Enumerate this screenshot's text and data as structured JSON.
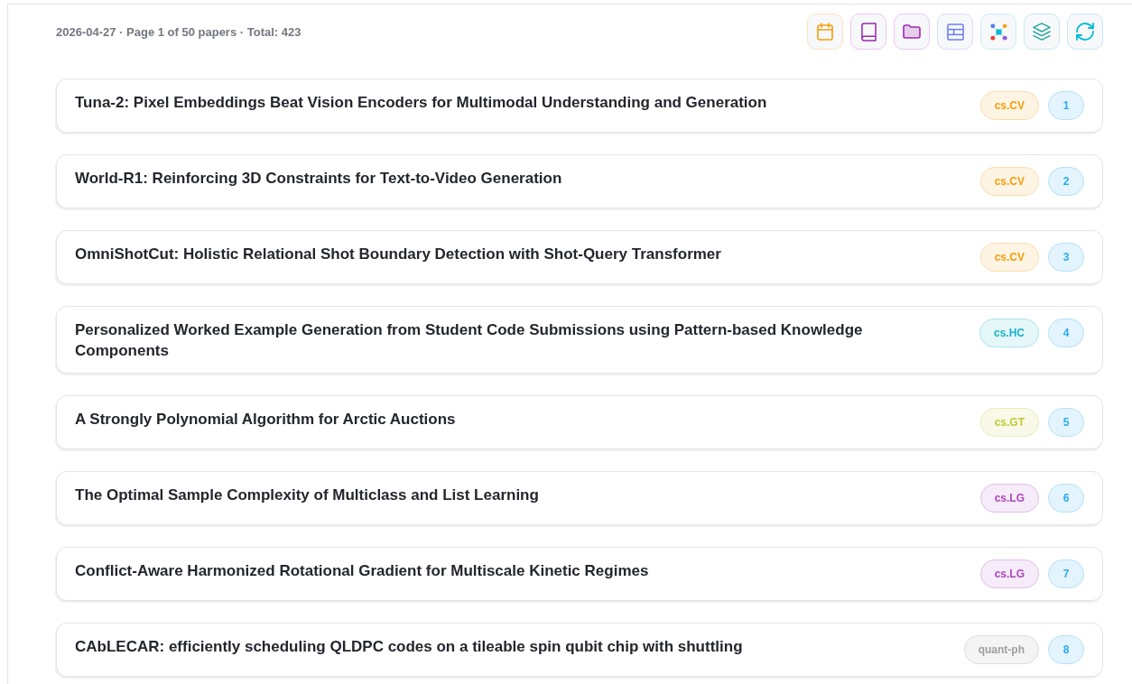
{
  "header": {
    "summary": "2026-04-27 · Page 1 of 50 papers · Total: 423"
  },
  "toolbar": [
    {
      "kind": "calendar"
    },
    {
      "kind": "book"
    },
    {
      "kind": "folder"
    },
    {
      "kind": "layout"
    },
    {
      "kind": "network"
    },
    {
      "kind": "layers"
    },
    {
      "kind": "refresh"
    }
  ],
  "papers": [
    {
      "title": "Tuna-2: Pixel Embeddings Beat Vision Encoders for Multimodal Understanding and Generation",
      "category": "cs.CV",
      "color": "#f59e0b",
      "rank": "1"
    },
    {
      "title": "World-R1: Reinforcing 3D Constraints for Text-to-Video Generation",
      "category": "cs.CV",
      "color": "#f59e0b",
      "rank": "2"
    },
    {
      "title": "OmniShotCut: Holistic Relational Shot Boundary Detection with Shot-Query Transformer",
      "category": "cs.CV",
      "color": "#f59e0b",
      "rank": "3"
    },
    {
      "title": "Personalized Worked Example Generation from Student Code Submissions using Pattern-based Knowledge Components",
      "category": "cs.HC",
      "color": "#17b3c8",
      "rank": "4"
    },
    {
      "title": "A Strongly Polynomial Algorithm for Arctic Auctions",
      "category": "cs.GT",
      "color": "#c0ca33",
      "rank": "5"
    },
    {
      "title": "The Optimal Sample Complexity of Multiclass and List Learning",
      "category": "cs.LG",
      "color": "#ab47bc",
      "rank": "6"
    },
    {
      "title": "Conflict-Aware Harmonized Rotational Gradient for Multiscale Kinetic Regimes",
      "category": "cs.LG",
      "color": "#ab47bc",
      "rank": "7"
    },
    {
      "title": "CAbLECAR: efficiently scheduling QLDPC codes on a tileable spin qubit chip with shuttling",
      "category": "quant-ph",
      "color": "#9e9e9e",
      "rank": "8"
    }
  ]
}
